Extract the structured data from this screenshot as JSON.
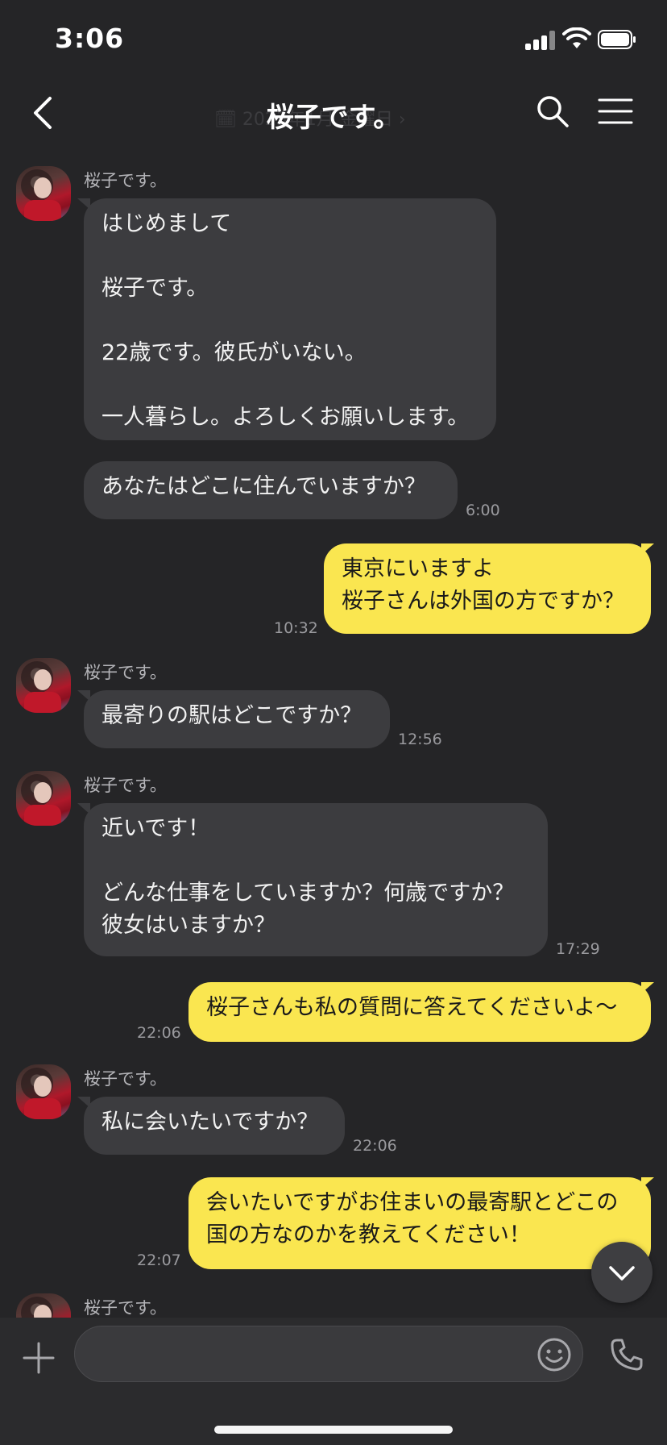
{
  "status_bar": {
    "time": "3:06"
  },
  "header": {
    "title": "桜子です。",
    "date_ghost": "🗓 2023年1月 金曜日 ›"
  },
  "messages": [
    {
      "sender": "桜子です。",
      "text": "はじめまして\n\n桜子です。\n\n22歳です。彼氏がいない。\n\n一人暮らし。よろしくお願いします。"
    },
    {
      "text": "あなたはどこに住んでいますか？",
      "time": "6:00"
    },
    {
      "text": "東京にいますよ\n桜子さんは外国の方ですか？",
      "time": "10:32"
    },
    {
      "sender": "桜子です。",
      "text": "最寄りの駅はどこですか？",
      "time": "12:56"
    },
    {
      "sender": "桜子です。",
      "text": "近いです！\n\nどんな仕事をしていますか？何歳ですか？\n彼女はいますか？",
      "time": "17:29"
    },
    {
      "text": "桜子さんも私の質問に答えてくださいよ〜",
      "time": "22:06"
    },
    {
      "sender": "桜子です。",
      "text": "私に会いたいですか？",
      "time": "22:06"
    },
    {
      "text": "会いたいですがお住まいの最寄駅とどこの\n国の方なのかを教えてください！",
      "time": "22:07"
    },
    {
      "sender": "桜子です。"
    }
  ],
  "input": {
    "value": "",
    "placeholder": ""
  },
  "colors": {
    "background": "#252527",
    "incoming_bubble": "#3c3c3f",
    "outgoing_bubble": "#fae650"
  }
}
